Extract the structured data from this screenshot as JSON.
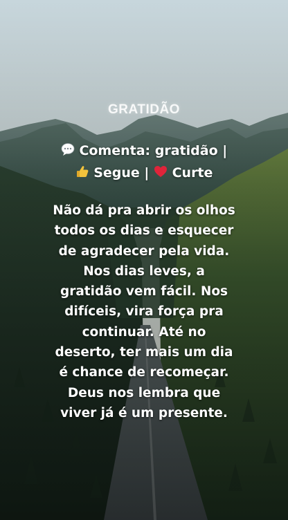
{
  "post": {
    "title": "GRATIDÃO",
    "cta": {
      "comment_label": "Comenta: gratidão |",
      "follow_label": "Segue |",
      "like_label": "Curte"
    },
    "message_lines": [
      "Não dá pra abrir os olhos",
      "todos os dias e esquecer",
      "de agradecer pela vida.",
      "Nos dias leves, a",
      "gratidão vem fácil. Nos",
      "difíceis, vira força pra",
      "continuar. Até no",
      "deserto, ter mais um dia",
      "é chance de recomeçar.",
      "Deus nos lembra que",
      "viver já é um presente."
    ]
  },
  "icons": {
    "comment": "speech-bubble-icon",
    "follow": "thumbs-up-icon",
    "like": "red-heart-icon"
  },
  "colors": {
    "text": "#ffffff",
    "sky_top": "#c9d9df",
    "forest": "#1f3524",
    "heart": "#e0243a",
    "thumb": "#f4c33c"
  }
}
